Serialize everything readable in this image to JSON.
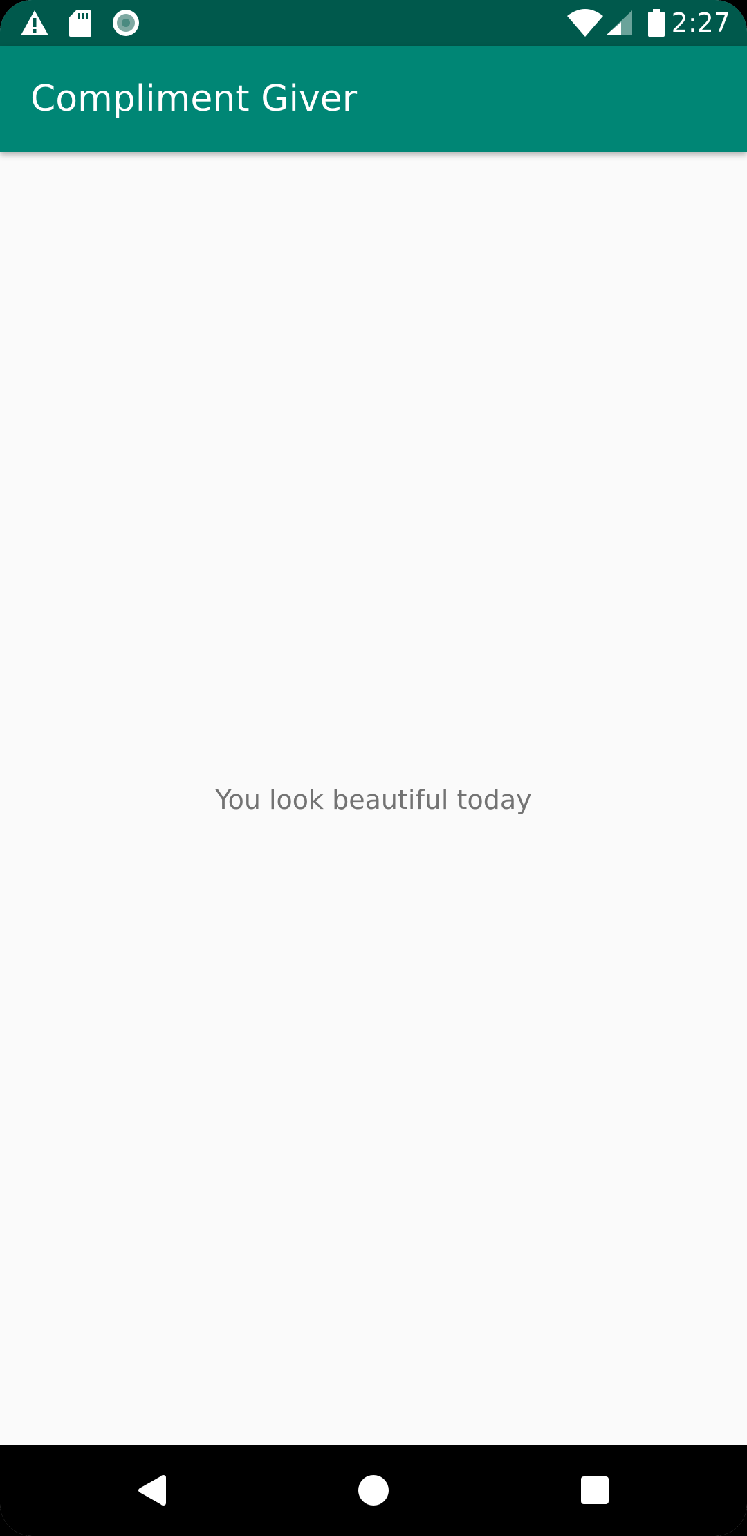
{
  "status_bar": {
    "time": "2:27",
    "left_icons": [
      "warning-icon",
      "sd-card-icon",
      "record-icon"
    ],
    "right_icons": [
      "wifi-icon",
      "cellular-signal-icon",
      "battery-icon"
    ]
  },
  "app_bar": {
    "title": "Compliment Giver",
    "color": "#008675"
  },
  "main": {
    "compliment_text": "You look beautiful today"
  },
  "nav_bar": {
    "buttons": [
      "back-icon",
      "home-icon",
      "recents-icon"
    ]
  },
  "colors": {
    "status_bar": "#00594c",
    "app_bar": "#008675",
    "background": "#fafafa",
    "text": "#737373"
  }
}
